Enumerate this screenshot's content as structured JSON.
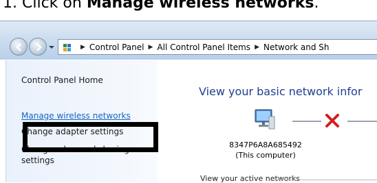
{
  "instruction": {
    "number": "1.",
    "prefix": "Click on ",
    "bold": "Manage wireless networks",
    "suffix": "."
  },
  "address_bar": {
    "crumbs": [
      "Control Panel",
      "All Control Panel Items",
      "Network and Sh"
    ]
  },
  "sidebar": {
    "home": "Control Panel Home",
    "links": [
      "Manage wireless networks",
      "Change adapter settings",
      "Change advanced sharing settings"
    ]
  },
  "main": {
    "title": "View your basic network infor",
    "computer_name": "8347P6A8A685492",
    "computer_caption": "(This computer)",
    "active_networks": "View your active networks"
  },
  "colors": {
    "link": "#1565c0",
    "title": "#1e3f8f",
    "highlight": "#000000",
    "error_x": "#d21f1f"
  }
}
